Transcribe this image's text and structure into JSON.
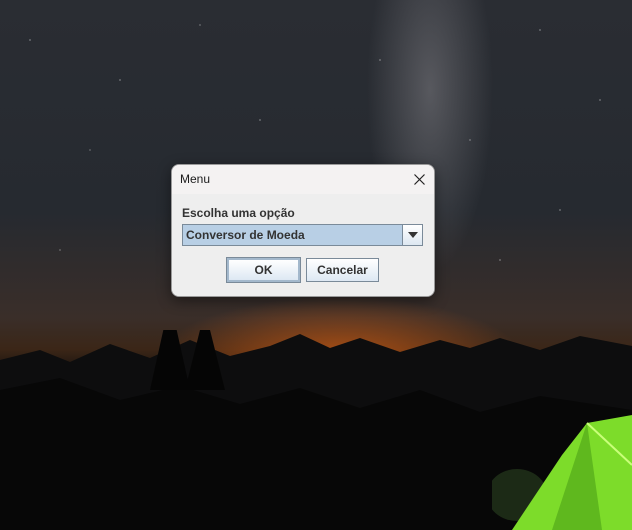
{
  "dialog": {
    "title": "Menu",
    "close_icon": "close-icon",
    "prompt": "Escolha uma opção",
    "combo": {
      "selected": "Conversor de Moeda",
      "arrow_icon": "chevron-down-icon"
    },
    "ok_label": "OK",
    "cancel_label": "Cancelar"
  },
  "colors": {
    "dialog_bg": "#eeeeee",
    "combo_bg": "#b8cfe5",
    "tent_green": "#7ddc2a"
  }
}
